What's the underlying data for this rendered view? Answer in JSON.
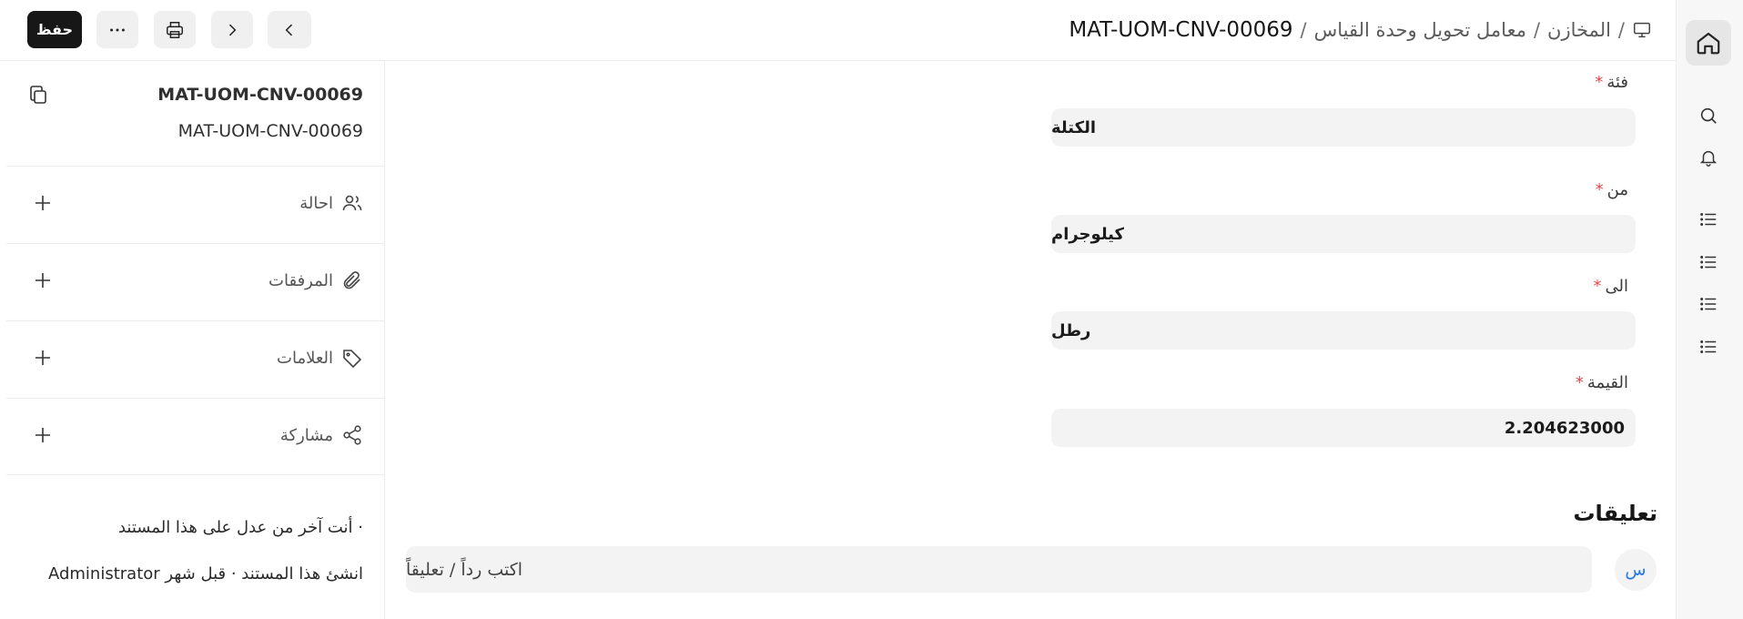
{
  "header": {
    "save_label": "حفظ",
    "breadcrumbs": [
      "المخازن",
      "معامل تحويل وحدة القياس"
    ],
    "separator": "/",
    "doc_title": "MAT-UOM-CNV-00069"
  },
  "sidebar": {
    "doc_name_bold": "MAT-UOM-CNV-00069",
    "doc_name": "MAT-UOM-CNV-00069",
    "items": [
      {
        "label": "احالة",
        "icon": "users-icon"
      },
      {
        "label": "المرفقات",
        "icon": "paperclip-icon"
      },
      {
        "label": "العلامات",
        "icon": "tag-icon"
      },
      {
        "label": "مشاركة",
        "icon": "share-icon"
      }
    ],
    "last_edited": "أنت آخر من عدل على هذا المستند ·",
    "created": "Administrator انشئ هذا المستند · قبل شهر"
  },
  "form": {
    "fields": [
      {
        "label": "فئة",
        "required": "*",
        "value": "الكتلة"
      },
      {
        "label": "من",
        "required": "*",
        "value": "كيلوجرام"
      },
      {
        "label": "الى",
        "required": "*",
        "value": "رطل"
      },
      {
        "label": "القيمة",
        "required": "*",
        "value": "2.204623000"
      }
    ]
  },
  "comments": {
    "title": "تعليقات",
    "avatar_initial": "س",
    "placeholder": "اكتب رداً / تعليقاً"
  },
  "colors": {
    "accent": "#171717",
    "required": "#e5484d",
    "avatar_text": "#2b7be5"
  }
}
